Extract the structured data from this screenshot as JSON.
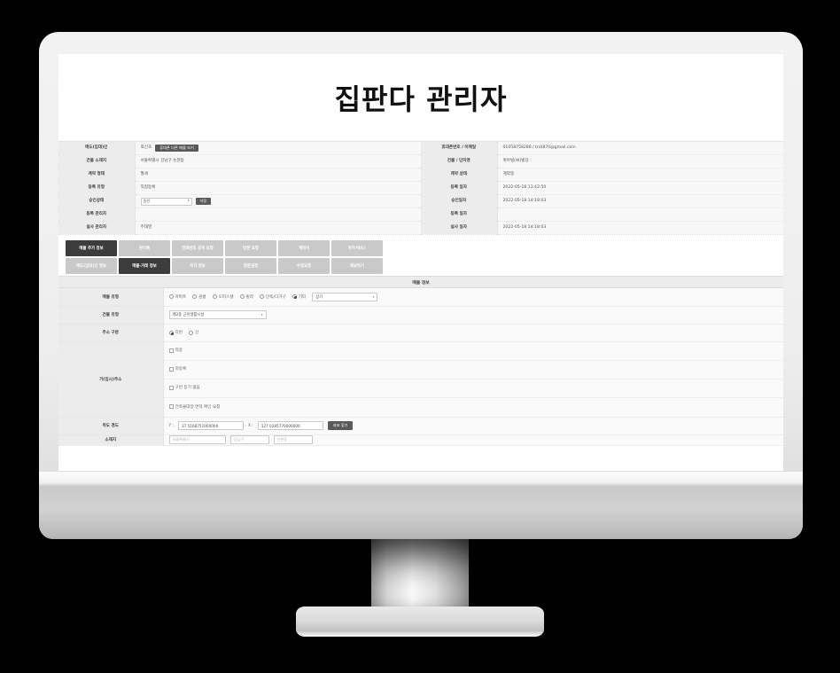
{
  "app": {
    "title": "집판다 관리자"
  },
  "summary": {
    "left_rows": [
      {
        "label": "매도(임대)인",
        "value": "최신호",
        "button": "휴대폰 다른 매물 보기"
      },
      {
        "label": "건물 소재지",
        "value": "서울특별시 강남구 논현동"
      },
      {
        "label": "계약 형태",
        "value": "월세"
      },
      {
        "label": "등록 유형",
        "value": "직접등록"
      },
      {
        "label": "승인상태",
        "select_value": "승인",
        "button": "저장"
      },
      {
        "label": "등록 관리자",
        "value": ""
      },
      {
        "label": "실사 관리자",
        "value": "주태영"
      }
    ],
    "right_rows": [
      {
        "label": "휴대폰번호 / 이메일",
        "value": "01058758288 / trot870@gmail.com"
      },
      {
        "label": "건물 / 단지명",
        "value": "위아빌(W)빌딩"
      },
      {
        "label": "계약 상태",
        "value": "계약중"
      },
      {
        "label": "등록 일자",
        "value": "2022-05-18 13:42:50"
      },
      {
        "label": "승인일자",
        "value": "2022-05-18 14:18:03"
      },
      {
        "label": "등록 일자",
        "value": ""
      },
      {
        "label": "실사 일자",
        "value": "2022-05-18 14:18:03"
      }
    ]
  },
  "tabs": {
    "row1": [
      {
        "label": "매물 추가 정보",
        "active": true
      },
      {
        "label": "판다톡",
        "active": false
      },
      {
        "label": "전화번호 공개 요청",
        "active": false
      },
      {
        "label": "방문 요청",
        "active": false
      },
      {
        "label": "계약서",
        "active": false
      },
      {
        "label": "부가서비스",
        "active": false
      }
    ],
    "row2": [
      {
        "label": "매도(임대)인 정보",
        "active": false
      },
      {
        "label": "매물-거래 정보",
        "active": true
      },
      {
        "label": "추가 정보",
        "active": false
      },
      {
        "label": "방문설정",
        "active": false
      },
      {
        "label": "수정요청",
        "active": false
      },
      {
        "label": "제보하기",
        "active": false
      }
    ]
  },
  "section": {
    "title": "매물 정보"
  },
  "form": {
    "property_type": {
      "label": "매물 유형",
      "options": [
        {
          "label": "아파트",
          "selected": false
        },
        {
          "label": "원룸",
          "selected": false
        },
        {
          "label": "오피스텔",
          "selected": false
        },
        {
          "label": "빌라",
          "selected": false
        },
        {
          "label": "단독/다가구",
          "selected": false
        },
        {
          "label": "기타",
          "selected": true
        }
      ],
      "etc_select_value": "상가"
    },
    "building_type": {
      "label": "건물 유형",
      "select_value": "제2종 근린생활시설"
    },
    "address_division": {
      "label": "주소 구분",
      "options": [
        {
          "label": "지번",
          "selected": true
        },
        {
          "label": "신",
          "selected": false
        }
      ]
    },
    "temp_address": {
      "label": "가(임시)주소",
      "checks": [
        {
          "label": "적용",
          "checked": false
        },
        {
          "label": "미등록",
          "checked": false
        },
        {
          "label": "구번 등기 없음",
          "checked": false
        },
        {
          "label": "건축물대장 면적 확인 요청",
          "checked": false
        }
      ]
    },
    "coords": {
      "label": "위도 경도",
      "y_tag": "Y :",
      "y_value": "37.5168751000000",
      "x_tag": "X :",
      "x_value": "127.0285770000000",
      "button": "좌표 찾기"
    },
    "cut_row": {
      "label": "소재지",
      "field1": "서울특별시",
      "field2": "강남구",
      "field3": "논현동"
    }
  }
}
